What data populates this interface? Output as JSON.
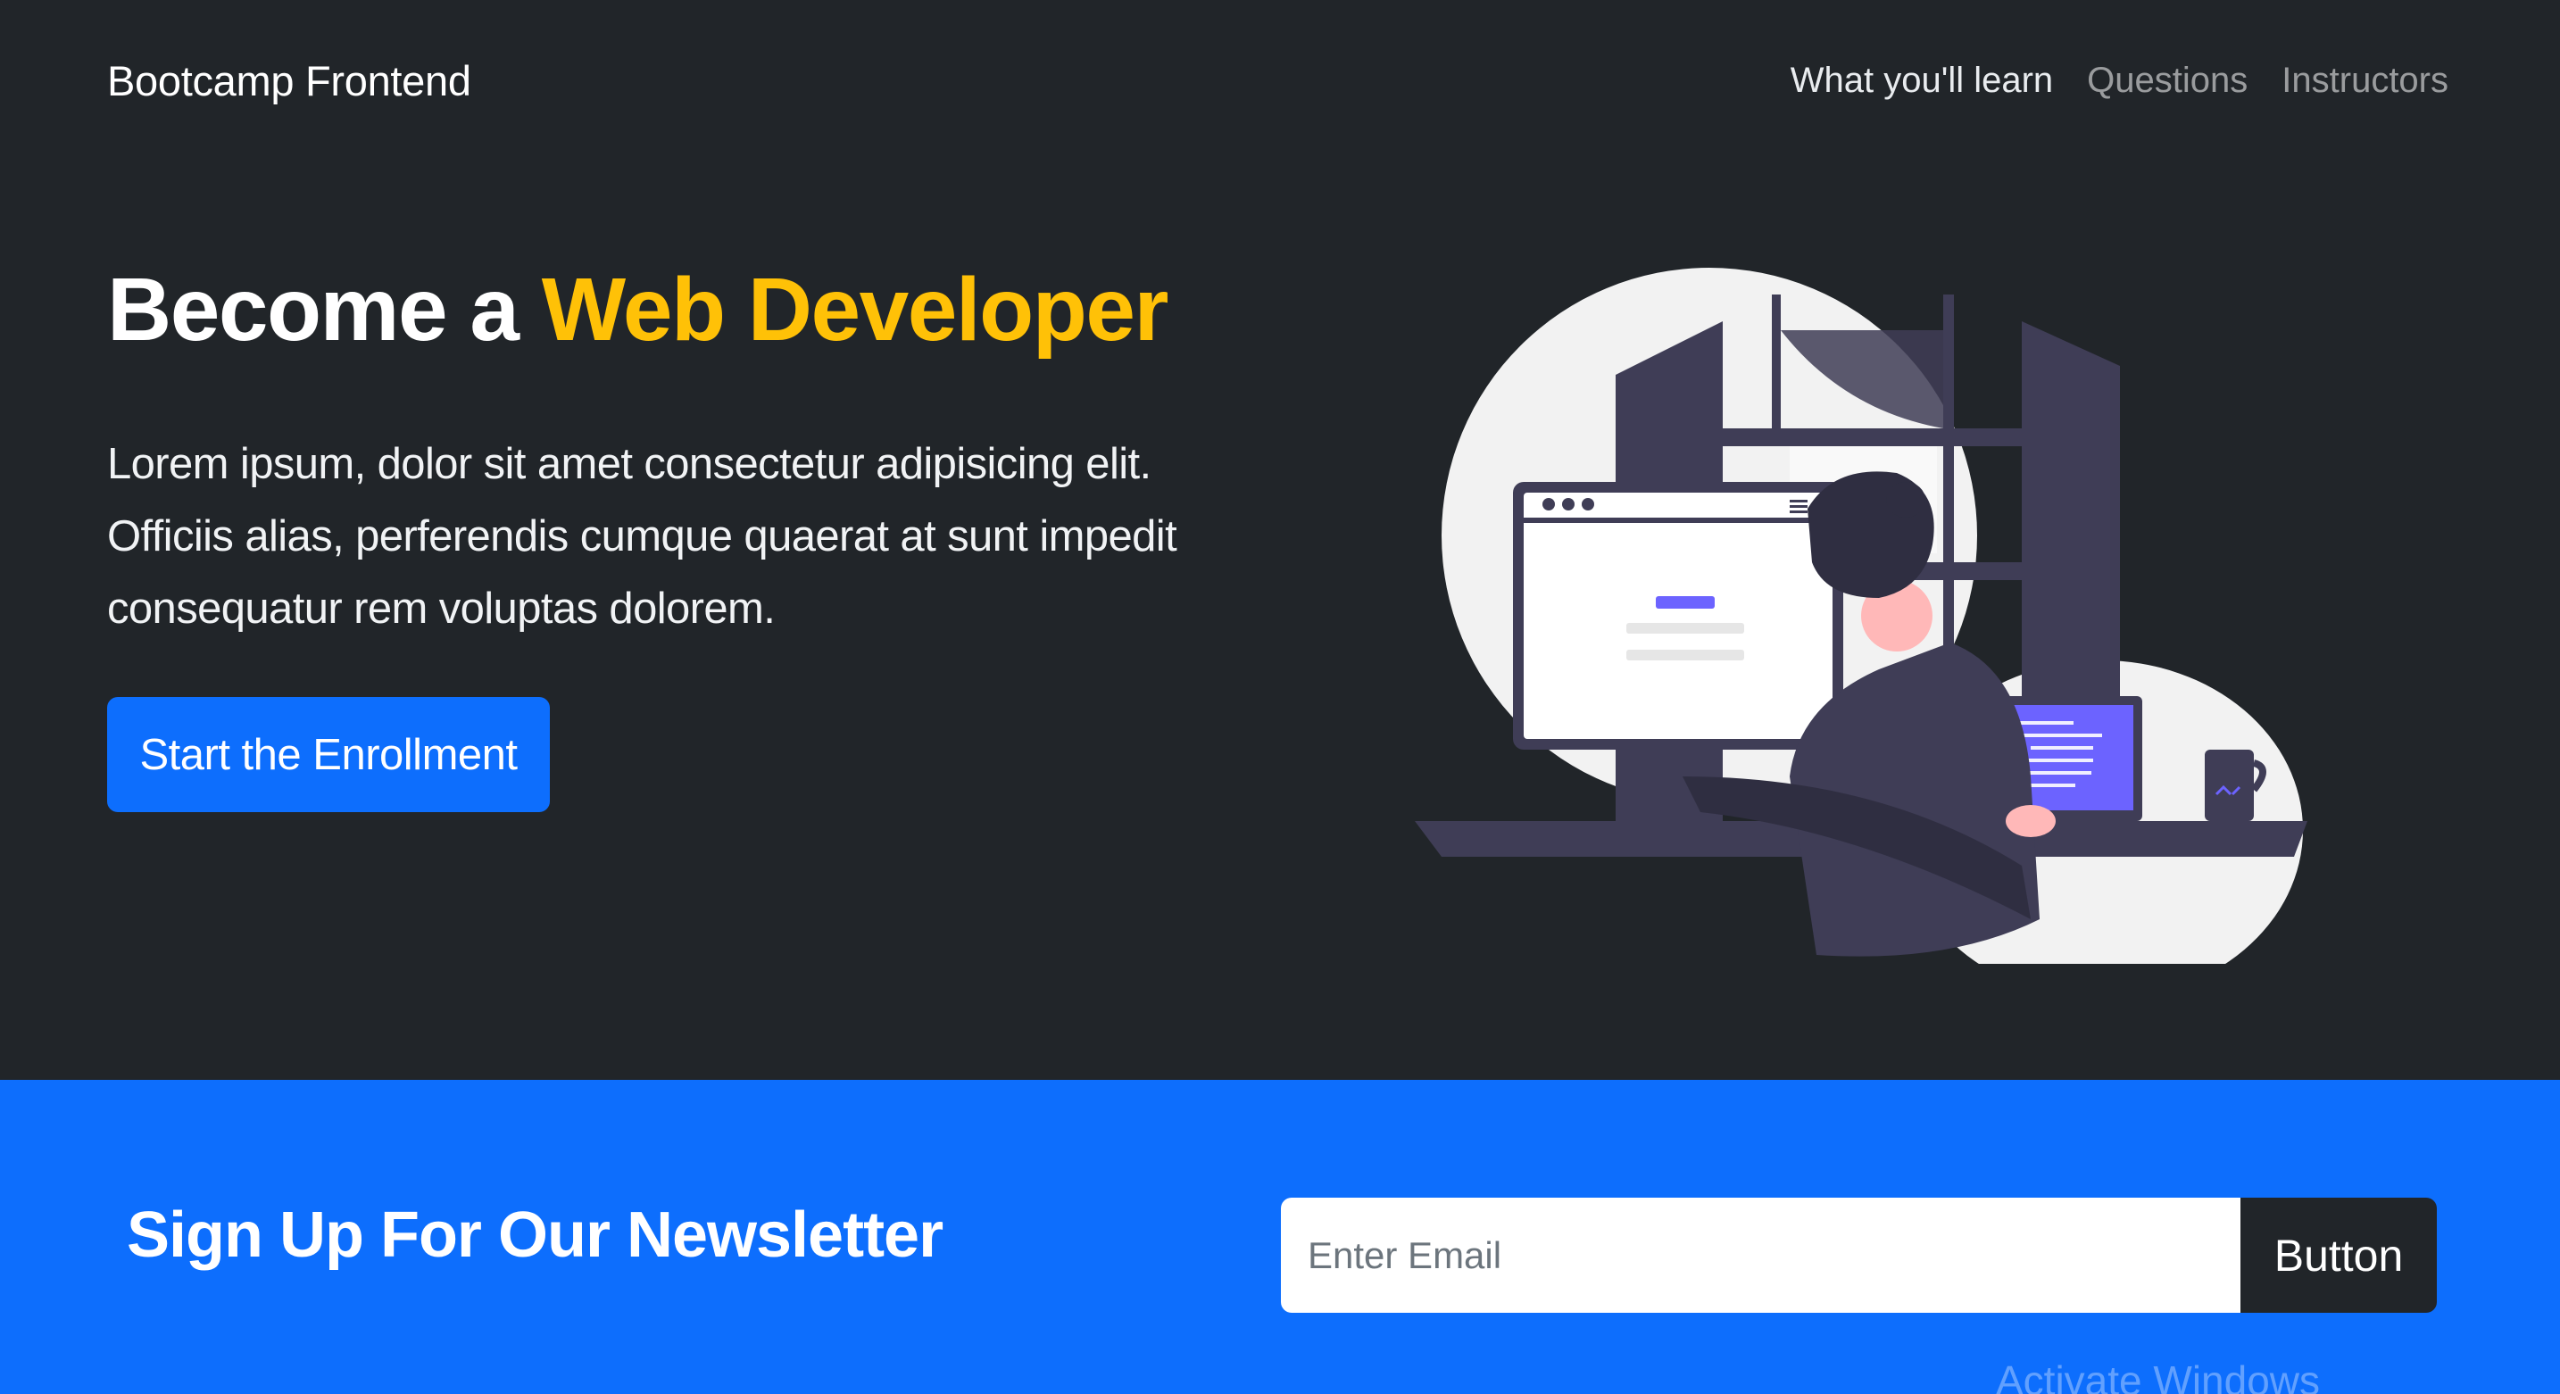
{
  "navbar": {
    "brand": "Bootcamp Frontend",
    "links": [
      {
        "label": "What you'll learn",
        "active": true
      },
      {
        "label": "Questions",
        "active": false
      },
      {
        "label": "Instructors",
        "active": false
      }
    ]
  },
  "hero": {
    "title_prefix": "Become a ",
    "title_accent": "Web Developer",
    "description": "Lorem ipsum, dolor sit amet consectetur adipisicing elit. Officiis alias, perferendis cumque quaerat at sunt impedit consequatur rem voluptas dolorem.",
    "cta_label": "Start the Enrollment",
    "illustration_icon": "developer-at-desk-illustration"
  },
  "newsletter": {
    "title": "Sign Up For Our Newsletter",
    "email_placeholder": "Enter Email",
    "email_value": "",
    "button_label": "Button"
  },
  "os_watermark": "Activate Windows",
  "colors": {
    "dark_bg": "#212529",
    "accent_yellow": "#ffc107",
    "primary_blue": "#0d6efd",
    "illustration_purple": "#6c63ff"
  }
}
